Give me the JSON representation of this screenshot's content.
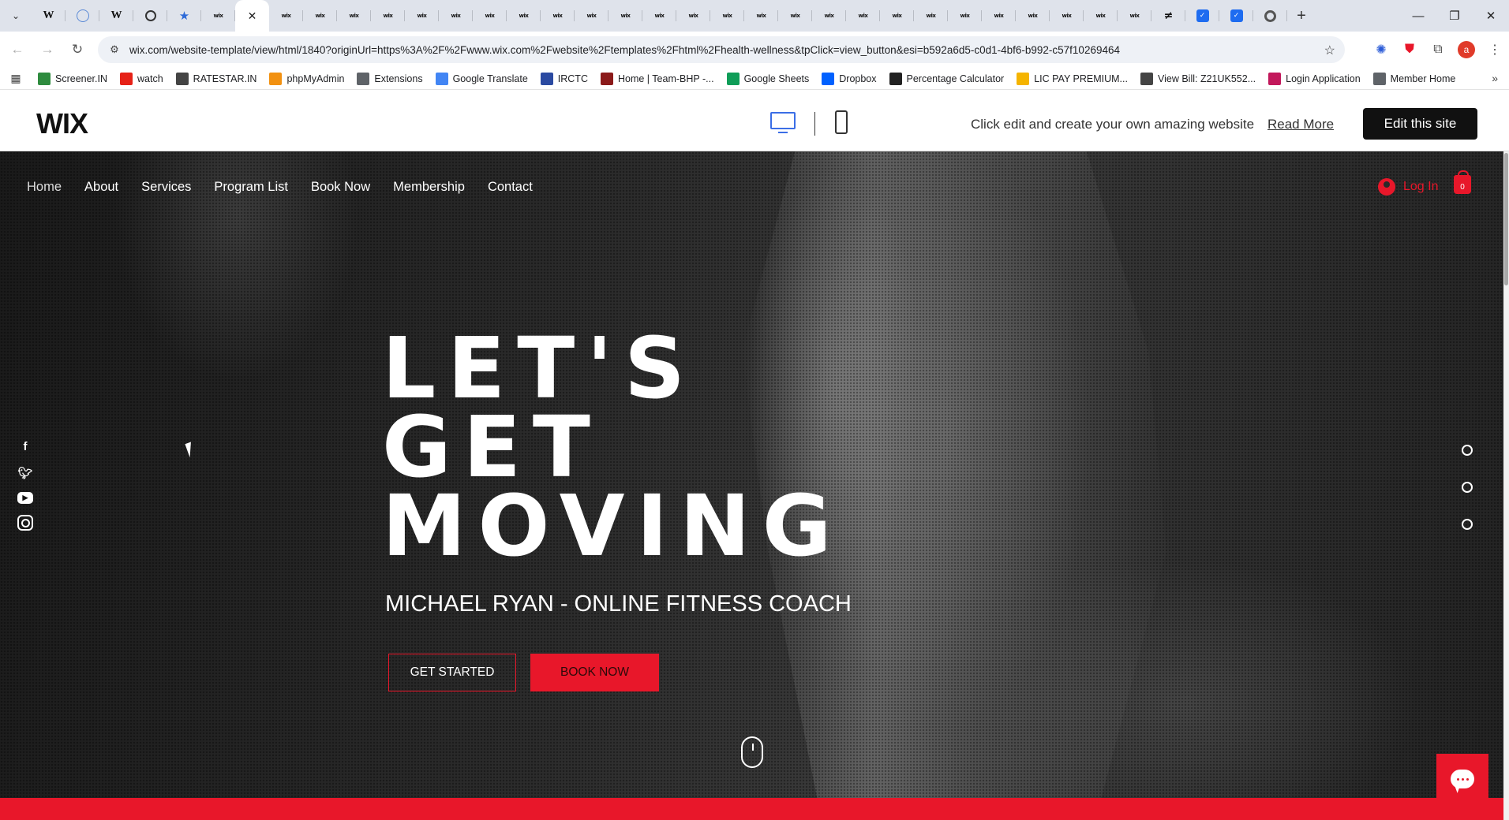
{
  "browser": {
    "tabs": [
      {
        "icon": "chevron-down-icon"
      },
      {
        "icon": "wikipedia-icon",
        "glyph": "W"
      },
      {
        "icon": "globe-icon",
        "glyph": ""
      },
      {
        "icon": "wikipedia-icon",
        "glyph": "W"
      },
      {
        "icon": "openai-icon",
        "glyph": ""
      },
      {
        "icon": "star-icon",
        "glyph": "★"
      },
      {
        "icon": "wix-icon",
        "glyph": "wix"
      }
    ],
    "active_tab_close": "✕",
    "url": "wix.com/website-template/view/html/1840?originUrl=https%3A%2F%2Fwww.wix.com%2Fwebsite%2Ftemplates%2Fhtml%2Fhealth-wellness&tpClick=view_button&esi=b592a6d5-c0d1-4bf6-b992-c57f10269464",
    "avatar_letter": "a"
  },
  "bookmarks": [
    {
      "label": "Screener.IN",
      "icon": "screener-icon",
      "color": "#2e8b3e"
    },
    {
      "label": "watch",
      "icon": "youtube-icon",
      "color": "#e62117"
    },
    {
      "label": "RATESTAR.IN",
      "icon": "ratestar-icon",
      "color": "#444444"
    },
    {
      "label": "phpMyAdmin",
      "icon": "phpmyadmin-icon",
      "color": "#f29111"
    },
    {
      "label": "Extensions",
      "icon": "puzzle-icon",
      "color": "#5f6368"
    },
    {
      "label": "Google Translate",
      "icon": "translate-icon",
      "color": "#4285f4"
    },
    {
      "label": "IRCTC",
      "icon": "irctc-icon",
      "color": "#2b4aa1"
    },
    {
      "label": "Home | Team-BHP -...",
      "icon": "teambhp-icon",
      "color": "#8b1a1a"
    },
    {
      "label": "Google Sheets",
      "icon": "sheets-icon",
      "color": "#0f9d58"
    },
    {
      "label": "Dropbox",
      "icon": "dropbox-icon",
      "color": "#0061ff"
    },
    {
      "label": "Percentage Calculator",
      "icon": "percent-icon",
      "color": "#222222"
    },
    {
      "label": "LIC PAY PREMIUM...",
      "icon": "lic-icon",
      "color": "#f5b400"
    },
    {
      "label": "View Bill: Z21UK552...",
      "icon": "bill-icon",
      "color": "#444444"
    },
    {
      "label": "Login Application",
      "icon": "login-app-icon",
      "color": "#c2185b"
    },
    {
      "label": "Member Home",
      "icon": "globe-icon",
      "color": "#5f6368"
    }
  ],
  "wixbar": {
    "logo": "WIX",
    "message": "Click edit and create your own amazing website",
    "read_more": "Read More",
    "edit_button": "Edit this site"
  },
  "site": {
    "nav": [
      "Home",
      "About",
      "Services",
      "Program List",
      "Book Now",
      "Membership",
      "Contact"
    ],
    "login_label": "Log In",
    "cart_count": "0",
    "headline": [
      "LET'S",
      "GET",
      "MOVING"
    ],
    "subtitle": "MICHAEL RYAN - ONLINE FITNESS COACH",
    "btn_get_started": "GET STARTED",
    "btn_book_now": "BOOK NOW",
    "social": [
      "facebook-icon",
      "twitter-icon",
      "youtube-icon",
      "instagram-icon"
    ],
    "accent_color": "#e8172a"
  }
}
